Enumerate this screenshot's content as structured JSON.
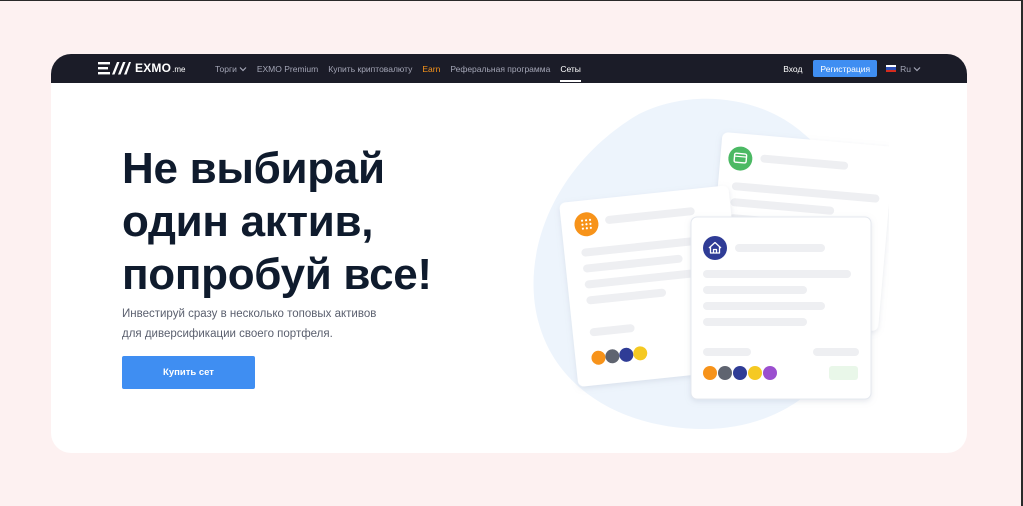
{
  "brand": {
    "name": "EXMO",
    "domain_suffix": ".me"
  },
  "nav": {
    "links": [
      {
        "label": "Торги",
        "has_dropdown": true
      },
      {
        "label": "EXMO Premium"
      },
      {
        "label": "Купить криптовалюту"
      },
      {
        "label": "Earn",
        "highlight_color": "#f7931a"
      },
      {
        "label": "Реферальная программа"
      },
      {
        "label": "Сеты",
        "active": true
      }
    ],
    "login_label": "Вход",
    "register_label": "Регистрация",
    "language": "Ru"
  },
  "hero": {
    "headline_lines": [
      "Не выбирай",
      "один актив,",
      "попробуй все!"
    ],
    "subtext_lines": [
      "Инвестируй сразу в несколько топовых активов",
      "для диверсификации своего портфеля."
    ],
    "cta_label": "Купить сет"
  },
  "colors": {
    "accent": "#3f8ef2",
    "nav_bg": "#1b1c28",
    "page_bg": "#fdf1f1",
    "headline": "#0f1b2d",
    "coin_colors": [
      "#f7931a",
      "#5f6470",
      "#2f3c96",
      "#f5c922",
      "#9b4fcf"
    ]
  },
  "illustration": {
    "card_icons": [
      "grid-icon",
      "wallet-icon",
      "home-icon"
    ]
  }
}
